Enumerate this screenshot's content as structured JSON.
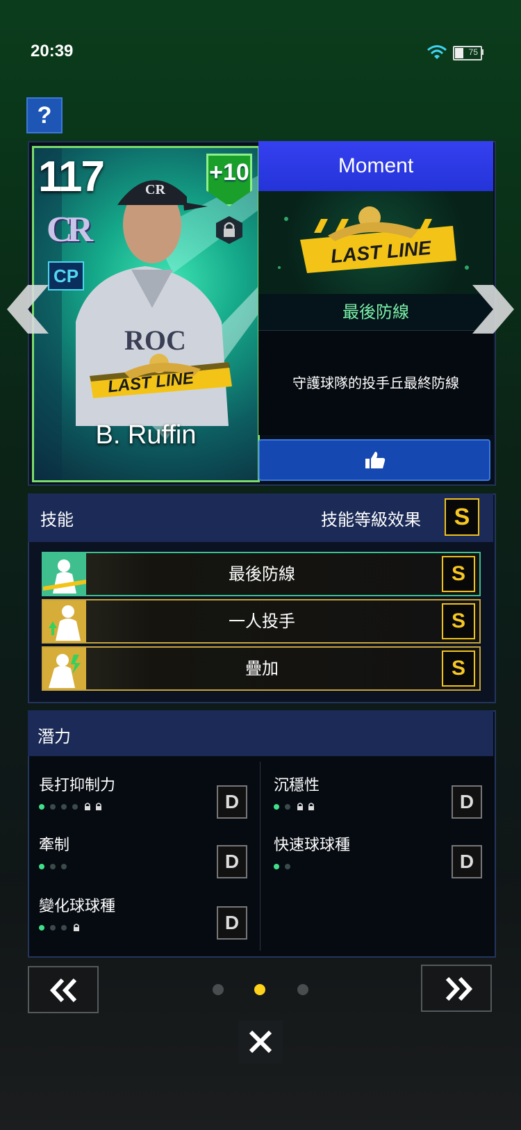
{
  "status_bar": {
    "time": "20:39",
    "battery": "75"
  },
  "help_label": "?",
  "card": {
    "ovr": "117",
    "team_logo": "CR",
    "position": "CP",
    "enhance": "+10",
    "name": "B. Ruffin",
    "badge_text": "LAST LINE"
  },
  "moment": {
    "header": "Moment",
    "badge_text": "LAST LINE",
    "skill_name": "最後防線",
    "description": "守護球隊的投手丘最終防線"
  },
  "skills": {
    "title": "技能",
    "effect_label": "技能等級效果",
    "effect_grade": "S",
    "items": [
      {
        "name": "最後防線",
        "grade": "S"
      },
      {
        "name": "一人投手",
        "grade": "S"
      },
      {
        "name": "疊加",
        "grade": "S"
      }
    ]
  },
  "potential": {
    "title": "潛力",
    "items": [
      {
        "label": "長打抑制力",
        "grade": "D",
        "dots_on": 1,
        "dots_off": 3,
        "locks": 2
      },
      {
        "label": "沉穩性",
        "grade": "D",
        "dots_on": 1,
        "dots_off": 1,
        "locks": 2
      },
      {
        "label": "牽制",
        "grade": "D",
        "dots_on": 1,
        "dots_off": 2,
        "locks": 0
      },
      {
        "label": "快速球球種",
        "grade": "D",
        "dots_on": 1,
        "dots_off": 1,
        "locks": 0
      },
      {
        "label": "變化球球種",
        "grade": "D",
        "dots_on": 1,
        "dots_off": 2,
        "locks": 1
      }
    ]
  },
  "pagination": {
    "total": 3,
    "current": 2
  },
  "colors": {
    "accent_gold": "#f0c21c",
    "potential_dot_on": "#40e08a",
    "moment_blue": "#2434d8"
  }
}
